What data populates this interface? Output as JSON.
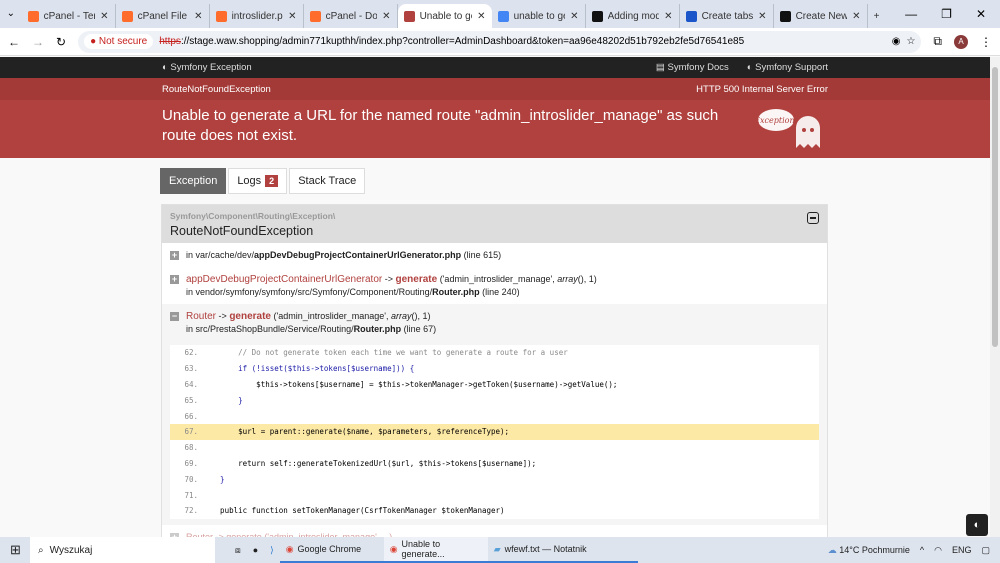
{
  "browser": {
    "tabs": [
      {
        "title": "cPanel - Term",
        "icon": "cpanel-icon",
        "color": "#ff6c2c"
      },
      {
        "title": "cPanel File M",
        "icon": "cpanel-icon",
        "color": "#ff6c2c"
      },
      {
        "title": "introslider.ph",
        "icon": "cpanel-icon",
        "color": "#ff6c2c"
      },
      {
        "title": "cPanel - Dom",
        "icon": "cpanel-icon",
        "color": "#ff6c2c"
      },
      {
        "title": "Unable to ge",
        "icon": "symfony-ghost-icon",
        "color": "#b0413e",
        "active": true
      },
      {
        "title": "unable to ge",
        "icon": "google-icon",
        "color": "#4285f4"
      },
      {
        "title": "Adding mod",
        "icon": "prestashop-icon",
        "color": "#111"
      },
      {
        "title": "Create tabs i",
        "icon": "webflow-icon",
        "color": "#1a55c9"
      },
      {
        "title": "Create New",
        "icon": "prestashop-icon",
        "color": "#111"
      }
    ],
    "not_secure": "Not secure",
    "url_scheme": "https",
    "url_rest": "://stage.waw.shopping/admin771kupthh/index.php?controller=AdminDashboard&token=aa96e48202d51b792eb2fe5d76541e85",
    "avatar": "A"
  },
  "symfony": {
    "brand": "Symfony Exception",
    "docs": "Symfony Docs",
    "support": "Symfony Support",
    "exception_class": "RouteNotFoundException",
    "http_status": "HTTP 500 Internal Server Error",
    "message": "Unable to generate a URL for the named route \"admin_introslider_manage\" as such route does not exist.",
    "ghost_text": "Exception!",
    "tabs": {
      "exception": "Exception",
      "logs": "Logs",
      "logs_count": "2",
      "stack": "Stack Trace"
    },
    "namespace": "Symfony\\Component\\Routing\\Exception\\",
    "class_name": "RouteNotFoundException",
    "trace": [
      {
        "prefix": "in var/cache/dev/",
        "file": "appDevDebugProjectContainerUrlGenerator.php",
        "line": "(line 615)"
      },
      {
        "cls": "appDevDebugProjectContainerUrlGenerator",
        "arrow": "->",
        "fn": "generate",
        "args": "('admin_introslider_manage', ",
        "arr": "array",
        "args2": "(), 1)",
        "prefix": "in vendor/symfony/symfony/src/Symfony/Component/Routing/",
        "file": "Router.php",
        "line": "(line 240)"
      },
      {
        "cls": "Router",
        "arrow": "->",
        "fn": "generate",
        "args": "('admin_introslider_manage', ",
        "arr": "array",
        "args2": "(), 1)",
        "prefix": "in src/PrestaShopBundle/Service/Routing/",
        "file": "Router.php",
        "line": "(line 67)"
      }
    ],
    "code": [
      {
        "n": "62.",
        "t": "        // Do not generate token each time we want to generate a route for a user",
        "cls": "c"
      },
      {
        "n": "63.",
        "t": "        if (!isset($this->tokens[$username])) {",
        "cls": "k"
      },
      {
        "n": "64.",
        "t": "            $this->tokens[$username] = $this->tokenManager->getToken($username)->getValue();",
        "cls": ""
      },
      {
        "n": "65.",
        "t": "        }",
        "cls": "k"
      },
      {
        "n": "66.",
        "t": "",
        "cls": ""
      },
      {
        "n": "67.",
        "t": "        $url = parent::generate($name, $parameters, $referenceType);",
        "cls": "",
        "hl": true
      },
      {
        "n": "68.",
        "t": "",
        "cls": ""
      },
      {
        "n": "69.",
        "t": "        return self::generateTokenizedUrl($url, $this->tokens[$username]);",
        "cls": ""
      },
      {
        "n": "70.",
        "t": "    }",
        "cls": "k"
      },
      {
        "n": "71.",
        "t": "",
        "cls": ""
      },
      {
        "n": "72.",
        "t": "    public function setTokenManager(CsrfTokenManager $tokenManager)",
        "cls": ""
      }
    ],
    "next_trace": "Router -> generate ('admin_introslider_manage', ...)"
  },
  "taskbar": {
    "search": "Wyszukaj",
    "apps": [
      "Google Chrome",
      "Unable to generate...",
      "wfewf.txt — Notatnik"
    ],
    "weather": "14°C  Pochmurnie",
    "lang": "ENG"
  }
}
